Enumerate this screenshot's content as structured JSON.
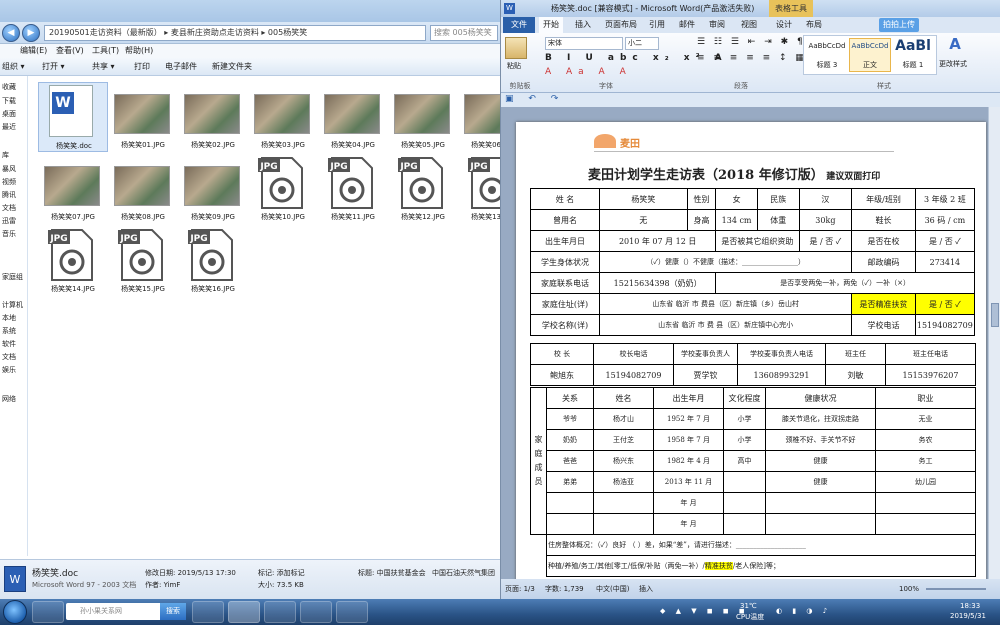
{
  "explorer": {
    "breadcrumb": "20190501走访资料（最新版） ▸ 麦县新庄资助点走访资料 ▸ 005杨笑笑",
    "search_placeholder": "搜索 005杨笑笑",
    "menu": [
      "编辑(E)",
      "查看(V)",
      "工具(T)",
      "帮助(H)"
    ],
    "toolbar": [
      "组织 ▾",
      "打开 ▾",
      "共享 ▾",
      "打印",
      "电子邮件",
      "新建文件夹"
    ],
    "nav_items": [
      "收藏",
      "下载",
      "桌面",
      "最近",
      "库",
      "暴风",
      "视频",
      "腾讯",
      "文档",
      "迅雷",
      "音乐",
      "家庭组",
      "计算机",
      "本地",
      "系统",
      "软件",
      "文档",
      "娱乐",
      "网络"
    ],
    "files": [
      {
        "name": "杨笑笑.doc",
        "kind": "word"
      },
      {
        "name": "杨笑笑01.JPG",
        "kind": "photo"
      },
      {
        "name": "杨笑笑02.JPG",
        "kind": "photo"
      },
      {
        "name": "杨笑笑03.JPG",
        "kind": "photo"
      },
      {
        "name": "杨笑笑04.JPG",
        "kind": "photo"
      },
      {
        "name": "杨笑笑05.JPG",
        "kind": "photo"
      },
      {
        "name": "杨笑笑06.JPG",
        "kind": "photo"
      },
      {
        "name": "杨笑笑07.JPG",
        "kind": "photo"
      },
      {
        "name": "杨笑笑08.JPG",
        "kind": "photo"
      },
      {
        "name": "杨笑笑09.JPG",
        "kind": "photo"
      },
      {
        "name": "杨笑笑10.JPG",
        "kind": "jpg"
      },
      {
        "name": "杨笑笑11.JPG",
        "kind": "jpg"
      },
      {
        "name": "杨笑笑12.JPG",
        "kind": "jpg"
      },
      {
        "name": "杨笑笑13.JPG",
        "kind": "jpg"
      },
      {
        "name": "杨笑笑14.JPG",
        "kind": "jpg"
      },
      {
        "name": "杨笑笑15.JPG",
        "kind": "jpg"
      },
      {
        "name": "杨笑笑16.JPG",
        "kind": "jpg"
      }
    ],
    "jpg_badge": "JPG",
    "details": {
      "name": "杨笑笑.doc",
      "type": "Microsoft Word 97 - 2003 文档",
      "modified": "修改日期: 2019/5/13 17:30",
      "author": "作者: YimF",
      "tags": "标记: 添加标记",
      "size": "大小: 73.5 KB",
      "title_label": "标题: 中国扶贫基金会",
      "title_extra": "中国石油天然气集团"
    }
  },
  "word": {
    "window_title": "杨笑笑.doc [兼容模式] - Microsoft Word(产品激活失败)",
    "table_tools": "表格工具",
    "tabs": [
      "文件",
      "开始",
      "插入",
      "页面布局",
      "引用",
      "邮件",
      "审阅",
      "视图",
      "设计",
      "布局"
    ],
    "share_label": "拍拍上传",
    "ribbon": {
      "paste": "粘贴",
      "font_name": "宋体",
      "font_size": "小二",
      "styles": [
        {
          "preview": "AaBbCcDd",
          "name": "标题 3"
        },
        {
          "preview": "AaBbCcDd",
          "name": "正文"
        },
        {
          "preview": "AaBl",
          "name": "标题 1"
        }
      ],
      "change_styles": "更改样式",
      "groups": [
        "剪贴板",
        "字体",
        "段落",
        "样式"
      ]
    },
    "doc": {
      "logo": "麦田",
      "title": "麦田计划学生走访表（2018 年修订版）",
      "subtitle": "建议双面打印",
      "rows1": [
        [
          "姓  名",
          "杨笑笑",
          "性别",
          "女",
          "民族",
          "汉",
          "年级/班别",
          "3 年级 2 班"
        ],
        [
          "曾用名",
          "无",
          "身高",
          "134 cm",
          "体重",
          "30kg",
          "鞋长",
          "36 码 / cm"
        ]
      ],
      "birth_label": "出生年月日",
      "birth_value": "2010 年 07 月 12 日",
      "orphan_label": "是否被其它组织资助",
      "orphan_value": "是 / 否 ✓",
      "school_label": "是否在校",
      "school_value": "是 / 否 ✓",
      "health_label": "学生身体状况",
      "health_value": "（✓）健康（）不健康（描述：________________）",
      "postcode_label": "邮政编码",
      "postcode_value": "273414",
      "phone_label": "家庭联系电话",
      "phone_value": "15215634398（奶奶）",
      "subsidy_value": "是否享受两免一补，两免（✓）一补（×）",
      "addr_label": "家庭住址(详)",
      "addr_value": "山东省 临沂 市 费县（区）新庄镇（乡）岳山村",
      "poor_label": "是否精准扶贫",
      "poor_value": "是 / 否 ✓",
      "school_name_label": "学校名称(详)",
      "school_name_value": "山东省 临沂 市 费 县（区）新庄镇中心完小",
      "school_phone_label": "学校电话",
      "school_phone_value": "15194082709",
      "staff_header": [
        "校  长",
        "校长电话",
        "学校麦事负责人",
        "学校麦事负责人电话",
        "班主任",
        "班主任电话"
      ],
      "staff_values": [
        "鲍旭东",
        "15194082709",
        "贾学钦",
        "13608993291",
        "刘敏",
        "15153976207"
      ],
      "family_label": "家庭成员",
      "family_header": [
        "关系",
        "姓名",
        "出生年月",
        "文化程度",
        "健康状况",
        "职业"
      ],
      "family_rows": [
        [
          "爷爷",
          "杨才山",
          "1952 年 7 月",
          "小学",
          "膝关节退化，拄双拐走路",
          "无业"
        ],
        [
          "奶奶",
          "王付芝",
          "1958 年 7 月",
          "小学",
          "颈椎不好、手关节不好",
          "务农"
        ],
        [
          "爸爸",
          "杨兴东",
          "1982 年 4 月",
          "高中",
          "健康",
          "务工"
        ],
        [
          "弟弟",
          "杨浩亚",
          "2013 年 11 月",
          "",
          "健康",
          "幼儿园"
        ],
        [
          "",
          "",
          "年  月",
          "",
          "",
          ""
        ],
        [
          "",
          "",
          "年  月",
          "",
          "",
          ""
        ]
      ],
      "housing": "住房整体概况：（✓）良好  （ ）差，如果“差”，请进行描述：____________________",
      "income_pre": "种植/养殖/务工/其他[零工/低保/补贴（两免一补）/",
      "income_hl": "精准扶贫",
      "income_post": "/老人保险]等；"
    },
    "status": {
      "page": "页面: 1/3",
      "words": "字数: 1,739",
      "lang": "中文(中国)",
      "mode": "插入",
      "zoom": "100%"
    }
  },
  "taskbar": {
    "search_placeholder": "孙小果关系网",
    "search_button": "搜索",
    "temp": "31℃",
    "cpu": "CPU温度",
    "time": "18:33",
    "date": "2019/5/31"
  }
}
